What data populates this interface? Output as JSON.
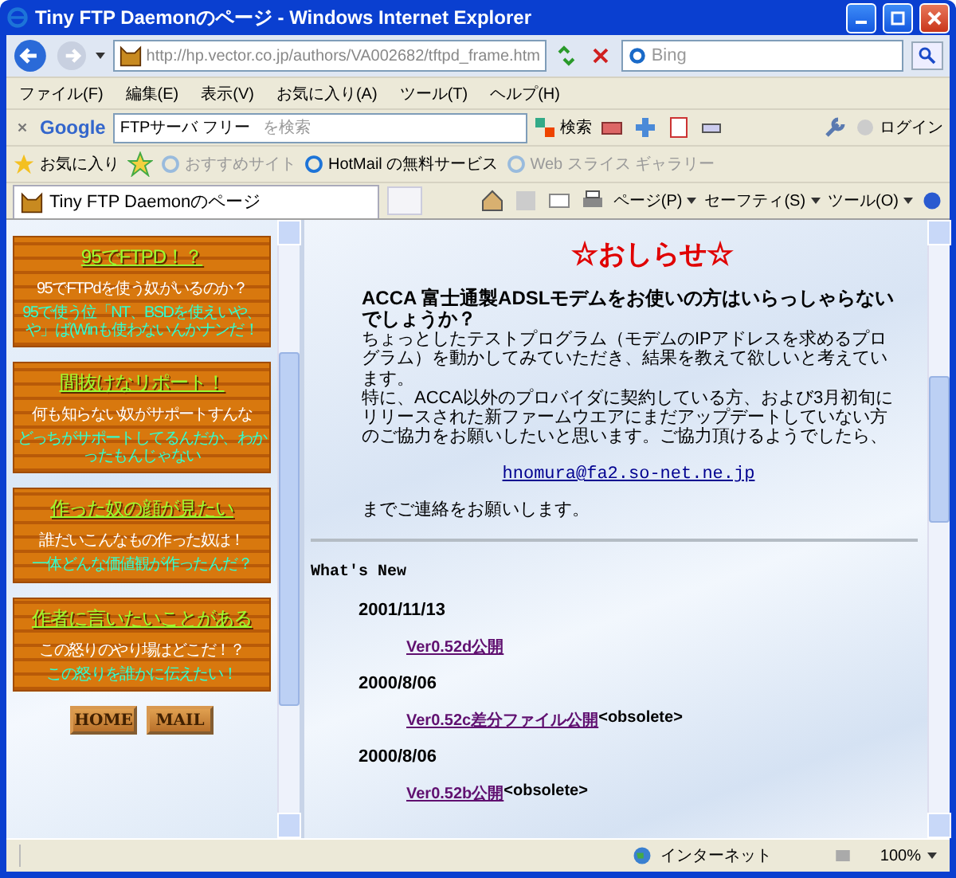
{
  "window": {
    "title": "Tiny FTP Daemonのページ - Windows Internet Explorer"
  },
  "address_bar": {
    "url": "http://hp.vector.co.jp/authors/VA002682/tftpd_frame.htm",
    "search_placeholder": "Bing"
  },
  "menu": [
    "ファイル(F)",
    "編集(E)",
    "表示(V)",
    "お気に入り(A)",
    "ツール(T)",
    "ヘルプ(H)"
  ],
  "google_bar": {
    "logo": "Google",
    "query": "FTPサーバ フリー",
    "hint": "を検索",
    "search_label": "検索",
    "login_label": "ログイン"
  },
  "favorites_bar": {
    "favorites": "お気に入り",
    "links": [
      {
        "label": "おすすめサイト",
        "disabled": true
      },
      {
        "label": "HotMail の無料サービス",
        "disabled": false
      },
      {
        "label": "Web スライス ギャラリー",
        "disabled": true
      }
    ]
  },
  "tab": {
    "title": "Tiny FTP Daemonのページ"
  },
  "commands": [
    "ページ(P)",
    "セーフティ(S)",
    "ツール(O)"
  ],
  "sidebar": {
    "cards": [
      {
        "title": "95でFTPD！？",
        "line": "95でFTPdを使う奴がいるのか？",
        "note": "95で使う位「NT、BSDを使えいや、や」ば(Winも使わないんかナンだ！"
      },
      {
        "title": "間抜けなリポート！",
        "line": "何も知らない奴がサポートすんな",
        "note": "どっちがサポートしてるんだか、わかったもんじゃない"
      },
      {
        "title": "作った奴の顔が見たい",
        "line": "誰だいこんなもの作った奴は！",
        "note": "一体どんな価値観が作ったんだ？"
      },
      {
        "title": "作者に言いたいことがある",
        "line": "この怒りのやり場はどこだ！？",
        "note": "この怒りを誰かに伝えたい！"
      }
    ],
    "buttons": [
      "HOME",
      "MAIL"
    ]
  },
  "main": {
    "heading": "☆おしらせ☆",
    "question": "ACCA 富士通製ADSLモデムをお使いの方はいらっしゃらないでしょうか？",
    "paragraphs": [
      "ちょっとしたテストプログラム（モデムのIPアドレスを求めるプログラム）を動かしてみていただき、結果を教えて欲しいと考えています。",
      "特に、ACCA以外のプロバイダに契約している方、および3月初旬にリリースされた新ファームウエアにまだアップデートしていない方のご協力をお願いしたいと思います。ご協力頂けるようでしたら、"
    ],
    "email": "hnomura@fa2.so-net.ne.jp",
    "closing": "までご連絡をお願いします。",
    "whats_new": "What's New",
    "entries": [
      {
        "date": "2001/11/13",
        "link": "Ver0.52d公開"
      },
      {
        "date": "2000/8/06",
        "link": "Ver0.52c差分ファイル公開",
        "suffix": "<obsolete>"
      },
      {
        "date": "2000/8/06",
        "link": "Ver0.52b公開",
        "suffix": "<obsolete>"
      }
    ]
  },
  "status_bar": {
    "zone": "インターネット",
    "zoom": "100%"
  }
}
